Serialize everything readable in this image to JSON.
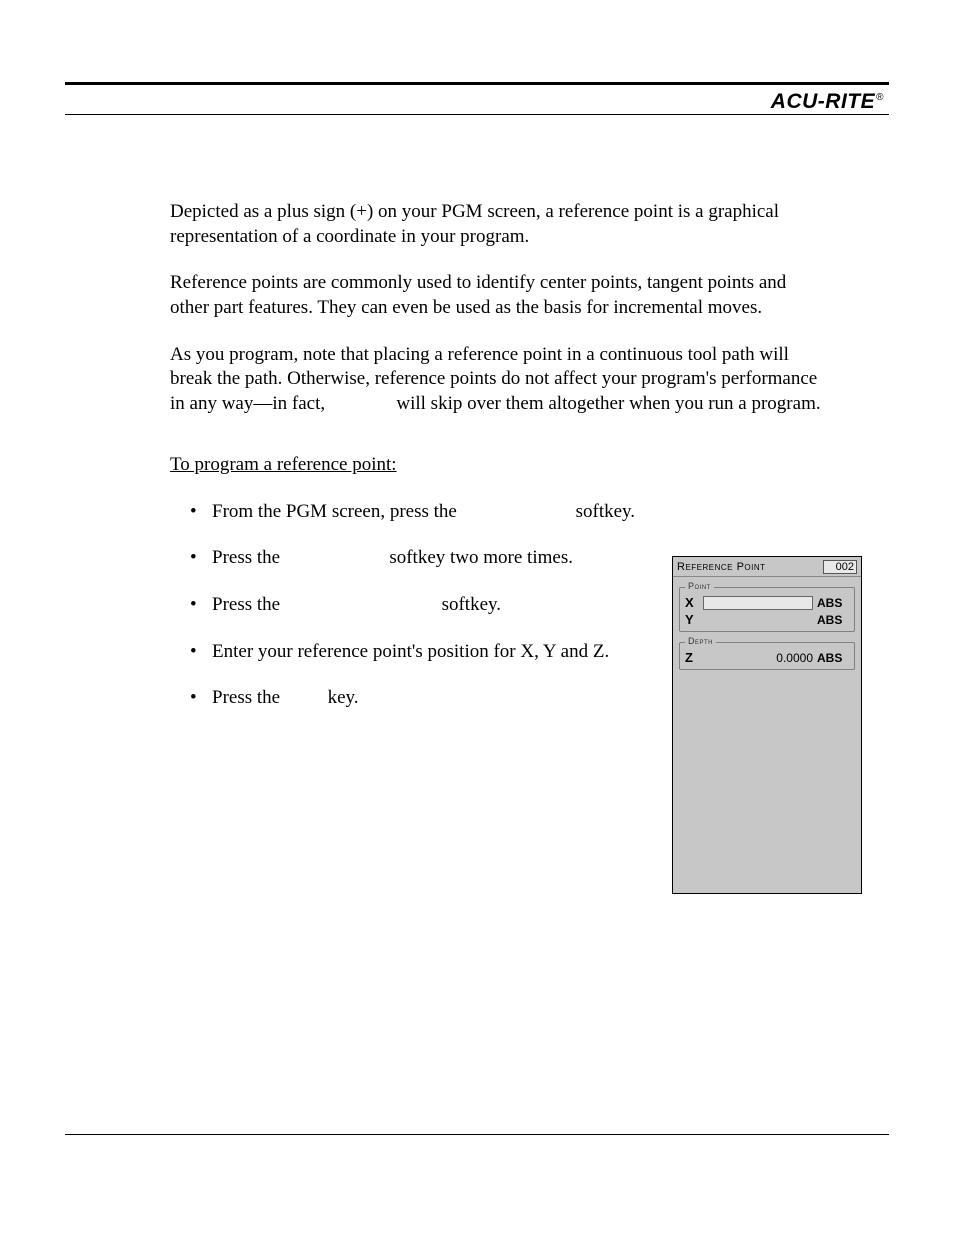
{
  "brand": "ACU-RITE",
  "paragraphs": {
    "p1": "Depicted as a plus sign (+) on your PGM screen, a reference point is a graphical representation of a coordinate in your program.",
    "p2": "Reference points are commonly used to identify center points, tangent points and other part features. They can even be used as the basis for incremental moves.",
    "p3a": "As you program, note that placing a reference point in a continuous tool path will break the path. Otherwise, reference points do not affect your program's performance in any way—in fact, ",
    "p3b": " will skip over them altogether when you run a program."
  },
  "subhead": "To program a reference point:",
  "steps": {
    "s1a": "From the PGM screen, press the ",
    "s1b": " softkey.",
    "s2a": "Press the ",
    "s2b": " softkey two more times.",
    "s3a": "Press the ",
    "s3b": " softkey.",
    "s4": "Enter your reference point's position for X, Y and Z.",
    "s5a": "Press the ",
    "s5b": " key."
  },
  "panel": {
    "title": "Reference Point",
    "number": "002",
    "group_point": "Point",
    "group_depth": "Depth",
    "axis_x": "X",
    "axis_y": "Y",
    "axis_z": "Z",
    "z_value": "0.0000",
    "mode_abs": "ABS"
  }
}
